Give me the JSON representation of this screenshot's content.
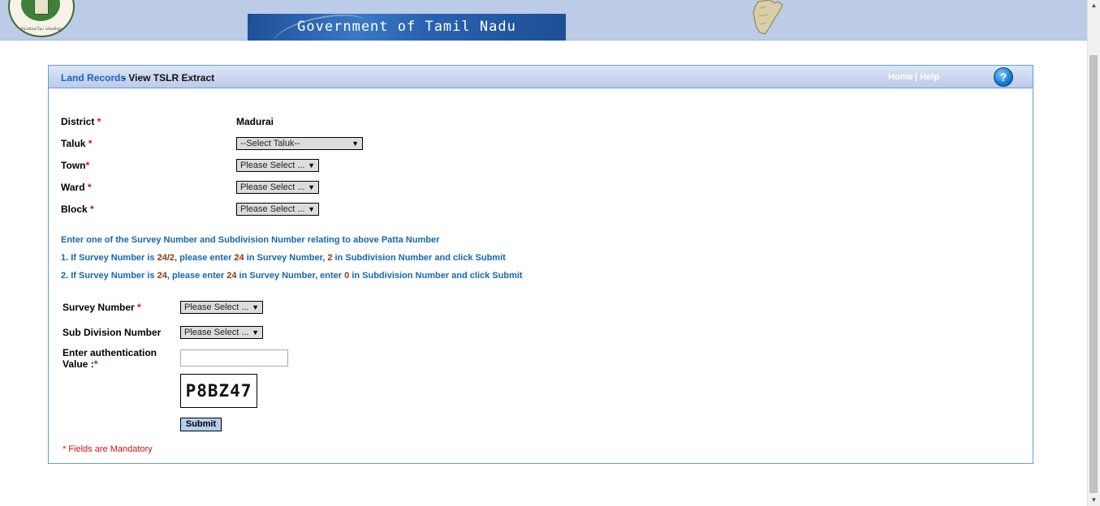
{
  "header": {
    "emblem_text": "வாய்மையே வெல்லும்",
    "banner_text": "Government of Tamil Nadu"
  },
  "panel": {
    "crumb_link": "Land Records",
    "crumb_rest": " - View TSLR Extract",
    "home": "Home",
    "separator": "|",
    "help": "Help",
    "help_icon": "?"
  },
  "form": {
    "district": {
      "label": "District",
      "required": "*",
      "value": "Madurai"
    },
    "taluk": {
      "label": "Taluk",
      "required": "*",
      "selected": "--Select Taluk--"
    },
    "town": {
      "label": "Town",
      "required": "*",
      "selected": "Please Select ..."
    },
    "ward": {
      "label": "Ward",
      "required": "*",
      "selected": "Please Select ..."
    },
    "block": {
      "label": "Block",
      "required": "*",
      "selected": "Please Select ..."
    }
  },
  "instructions": {
    "intro": "Enter one of the Survey Number and Subdivision Number relating to above Patta Number",
    "line1": {
      "a": "1. If Survey Number is ",
      "b": "24/2",
      "c": ", please enter ",
      "d": "24",
      "e": " in Survey Number, ",
      "f": "2",
      "g": " in Subdivision Number and click Submit"
    },
    "line2": {
      "a": "2. If Survey Number is ",
      "b": "24",
      "c": ", please enter ",
      "d": "24",
      "e": " in Survey Number, enter ",
      "f": "0",
      "g": " in Subdivision Number and click Submit"
    }
  },
  "survey": {
    "survey_number": {
      "label": "Survey Number",
      "required": "*",
      "selected": "Please Select ..."
    },
    "sub_division": {
      "label": "Sub Division Number",
      "selected": "Please Select ..."
    },
    "auth": {
      "label_line1": "Enter authentication",
      "label_line2": "Value :",
      "required": "*",
      "value": ""
    },
    "captcha": "P8BZ47",
    "submit": "Submit",
    "mandatory_note": "* Fields are Mandatory"
  },
  "scrollbar": {
    "up": "▲",
    "down": "▼"
  },
  "dropdown_arrow": "▼",
  "colors": {
    "header_bg": "#bccbe6",
    "link_blue": "#1a63c2",
    "info_blue": "#1467b0",
    "highlight": "#8b3a10",
    "required_red": "#d01010",
    "panel_border": "#5fa0d0",
    "submit_bg": "#b5cdef"
  }
}
